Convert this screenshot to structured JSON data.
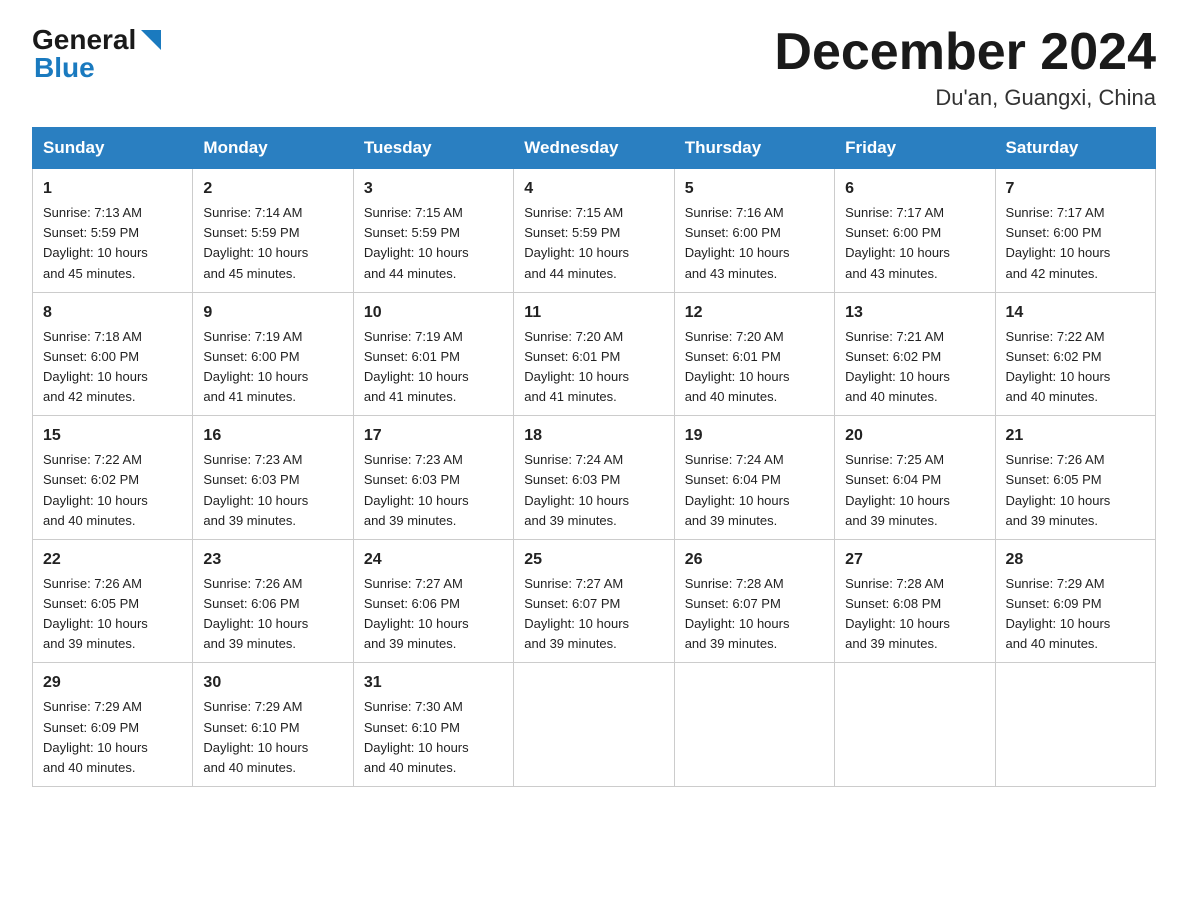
{
  "header": {
    "logo_general": "General",
    "logo_blue": "Blue",
    "title": "December 2024",
    "location": "Du'an, Guangxi, China"
  },
  "days_of_week": [
    "Sunday",
    "Monday",
    "Tuesday",
    "Wednesday",
    "Thursday",
    "Friday",
    "Saturday"
  ],
  "weeks": [
    [
      {
        "day": "1",
        "sunrise": "7:13 AM",
        "sunset": "5:59 PM",
        "daylight": "10 hours and 45 minutes."
      },
      {
        "day": "2",
        "sunrise": "7:14 AM",
        "sunset": "5:59 PM",
        "daylight": "10 hours and 45 minutes."
      },
      {
        "day": "3",
        "sunrise": "7:15 AM",
        "sunset": "5:59 PM",
        "daylight": "10 hours and 44 minutes."
      },
      {
        "day": "4",
        "sunrise": "7:15 AM",
        "sunset": "5:59 PM",
        "daylight": "10 hours and 44 minutes."
      },
      {
        "day": "5",
        "sunrise": "7:16 AM",
        "sunset": "6:00 PM",
        "daylight": "10 hours and 43 minutes."
      },
      {
        "day": "6",
        "sunrise": "7:17 AM",
        "sunset": "6:00 PM",
        "daylight": "10 hours and 43 minutes."
      },
      {
        "day": "7",
        "sunrise": "7:17 AM",
        "sunset": "6:00 PM",
        "daylight": "10 hours and 42 minutes."
      }
    ],
    [
      {
        "day": "8",
        "sunrise": "7:18 AM",
        "sunset": "6:00 PM",
        "daylight": "10 hours and 42 minutes."
      },
      {
        "day": "9",
        "sunrise": "7:19 AM",
        "sunset": "6:00 PM",
        "daylight": "10 hours and 41 minutes."
      },
      {
        "day": "10",
        "sunrise": "7:19 AM",
        "sunset": "6:01 PM",
        "daylight": "10 hours and 41 minutes."
      },
      {
        "day": "11",
        "sunrise": "7:20 AM",
        "sunset": "6:01 PM",
        "daylight": "10 hours and 41 minutes."
      },
      {
        "day": "12",
        "sunrise": "7:20 AM",
        "sunset": "6:01 PM",
        "daylight": "10 hours and 40 minutes."
      },
      {
        "day": "13",
        "sunrise": "7:21 AM",
        "sunset": "6:02 PM",
        "daylight": "10 hours and 40 minutes."
      },
      {
        "day": "14",
        "sunrise": "7:22 AM",
        "sunset": "6:02 PM",
        "daylight": "10 hours and 40 minutes."
      }
    ],
    [
      {
        "day": "15",
        "sunrise": "7:22 AM",
        "sunset": "6:02 PM",
        "daylight": "10 hours and 40 minutes."
      },
      {
        "day": "16",
        "sunrise": "7:23 AM",
        "sunset": "6:03 PM",
        "daylight": "10 hours and 39 minutes."
      },
      {
        "day": "17",
        "sunrise": "7:23 AM",
        "sunset": "6:03 PM",
        "daylight": "10 hours and 39 minutes."
      },
      {
        "day": "18",
        "sunrise": "7:24 AM",
        "sunset": "6:03 PM",
        "daylight": "10 hours and 39 minutes."
      },
      {
        "day": "19",
        "sunrise": "7:24 AM",
        "sunset": "6:04 PM",
        "daylight": "10 hours and 39 minutes."
      },
      {
        "day": "20",
        "sunrise": "7:25 AM",
        "sunset": "6:04 PM",
        "daylight": "10 hours and 39 minutes."
      },
      {
        "day": "21",
        "sunrise": "7:26 AM",
        "sunset": "6:05 PM",
        "daylight": "10 hours and 39 minutes."
      }
    ],
    [
      {
        "day": "22",
        "sunrise": "7:26 AM",
        "sunset": "6:05 PM",
        "daylight": "10 hours and 39 minutes."
      },
      {
        "day": "23",
        "sunrise": "7:26 AM",
        "sunset": "6:06 PM",
        "daylight": "10 hours and 39 minutes."
      },
      {
        "day": "24",
        "sunrise": "7:27 AM",
        "sunset": "6:06 PM",
        "daylight": "10 hours and 39 minutes."
      },
      {
        "day": "25",
        "sunrise": "7:27 AM",
        "sunset": "6:07 PM",
        "daylight": "10 hours and 39 minutes."
      },
      {
        "day": "26",
        "sunrise": "7:28 AM",
        "sunset": "6:07 PM",
        "daylight": "10 hours and 39 minutes."
      },
      {
        "day": "27",
        "sunrise": "7:28 AM",
        "sunset": "6:08 PM",
        "daylight": "10 hours and 39 minutes."
      },
      {
        "day": "28",
        "sunrise": "7:29 AM",
        "sunset": "6:09 PM",
        "daylight": "10 hours and 40 minutes."
      }
    ],
    [
      {
        "day": "29",
        "sunrise": "7:29 AM",
        "sunset": "6:09 PM",
        "daylight": "10 hours and 40 minutes."
      },
      {
        "day": "30",
        "sunrise": "7:29 AM",
        "sunset": "6:10 PM",
        "daylight": "10 hours and 40 minutes."
      },
      {
        "day": "31",
        "sunrise": "7:30 AM",
        "sunset": "6:10 PM",
        "daylight": "10 hours and 40 minutes."
      },
      null,
      null,
      null,
      null
    ]
  ],
  "labels": {
    "sunrise": "Sunrise:",
    "sunset": "Sunset:",
    "daylight": "Daylight:"
  }
}
